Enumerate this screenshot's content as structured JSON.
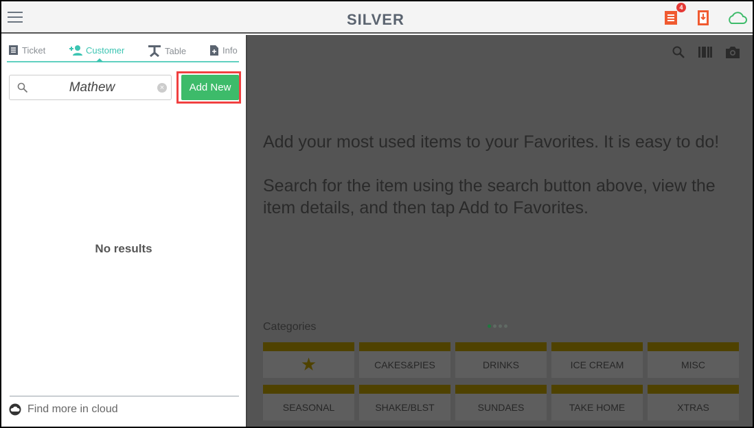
{
  "header": {
    "logo": "SILVER",
    "notification_count": "4",
    "icons": [
      "menu-icon",
      "ticket-icon",
      "download-icon",
      "cloud-icon"
    ],
    "colors": {
      "accent_orange": "#f05a30",
      "cloud_green": "#3dbb6a"
    }
  },
  "tabs": [
    {
      "label": "Ticket",
      "icon": "ticket-icon"
    },
    {
      "label": "Customer",
      "icon": "add-person-icon",
      "active": true
    },
    {
      "label": "Table",
      "icon": "table-icon"
    },
    {
      "label": "Info",
      "icon": "add-document-icon"
    }
  ],
  "search": {
    "value": "Mathew"
  },
  "add_new_label": "Add New",
  "no_results": "No results",
  "find_cloud": "Find more in cloud",
  "favorites_message": [
    "Add your most used items to your Favorites. It is easy to do!",
    "Search for the item using the search button above, view the item details, and then tap Add to Favorites."
  ],
  "categories_label": "Categories",
  "categories": [
    "CAKES&PIES",
    "DRINKS",
    "ICE CREAM",
    "MISC",
    "SEASONAL",
    "SHAKE/BLST",
    "SUNDAES",
    "TAKE HOME",
    "XTRAS"
  ],
  "favorites_tile_icon": "star-icon",
  "category_pages": {
    "total": 4,
    "current": 1
  },
  "colors": {
    "tab_active": "#3cc4b2",
    "add_new": "#3dbb6a",
    "highlight": "#f04040",
    "category_bar": "#c9a800"
  }
}
